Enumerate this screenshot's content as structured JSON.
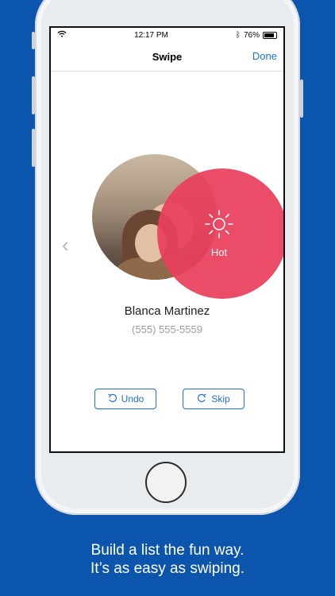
{
  "status": {
    "time": "12:17 PM",
    "battery": "76%"
  },
  "nav": {
    "title": "Swipe",
    "done": "Done"
  },
  "contact": {
    "name": "Blanca Martinez",
    "phone": "(555) 555-5559"
  },
  "overlay": {
    "label": "Hot",
    "icon": "sun-icon",
    "color": "#e9405c"
  },
  "actions": {
    "undo": "Undo",
    "skip": "Skip"
  },
  "caption": {
    "line1": "Build a list the fun way.",
    "line2": "It’s as easy as swiping."
  },
  "colors": {
    "accent": "#1f6fd1",
    "background": "#0b55ad"
  }
}
